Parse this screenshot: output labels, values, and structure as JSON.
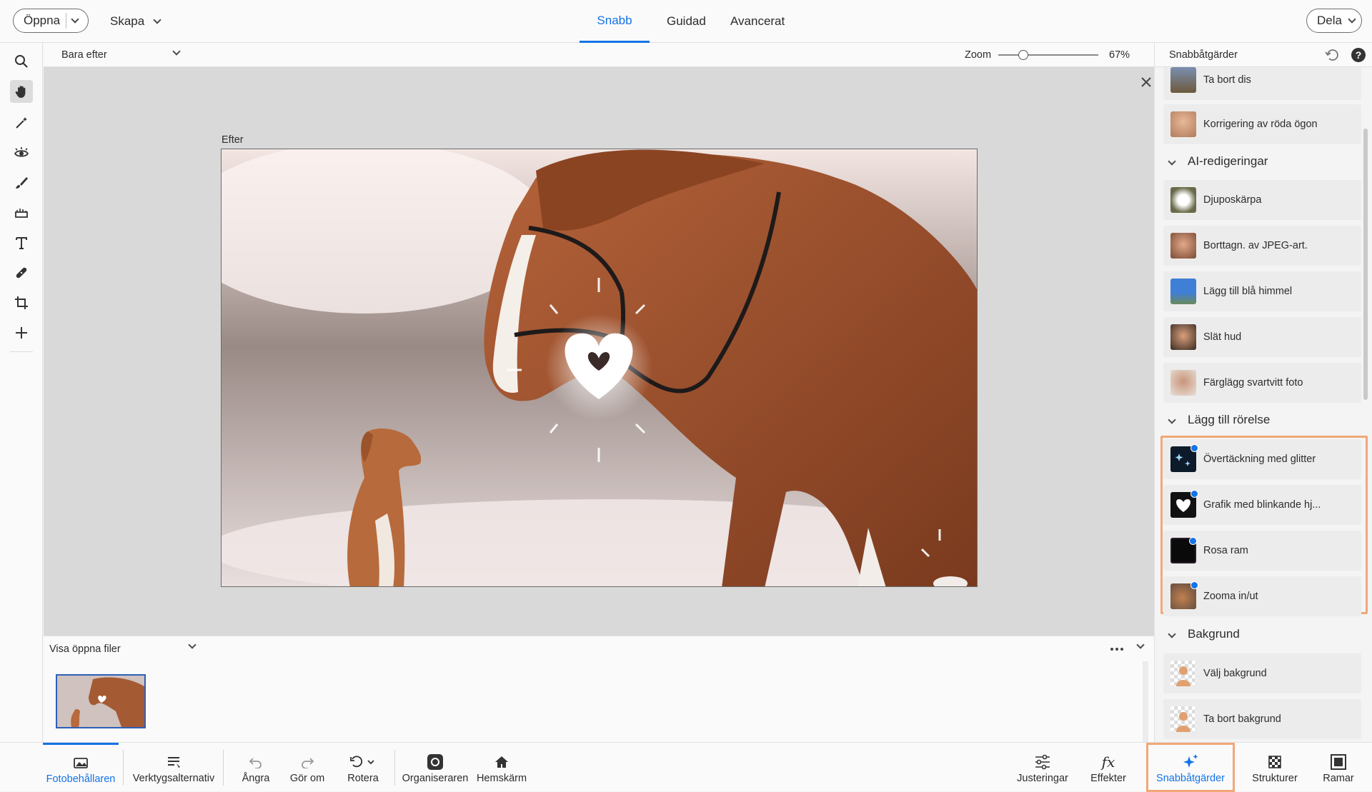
{
  "topbar": {
    "open_label": "Öppna",
    "create_label": "Skapa",
    "modes": [
      "Snabb",
      "Guidad",
      "Avancerat"
    ],
    "share_label": "Dela"
  },
  "subbar": {
    "view_select": "Bara efter",
    "zoom_label": "Zoom",
    "zoom_value": "67%",
    "zoom_fraction": 0.25
  },
  "canvas": {
    "after_label": "Efter"
  },
  "bin": {
    "show_files_label": "Visa öppna filer"
  },
  "panel": {
    "title": "Snabbåtgärder",
    "top_items": [
      {
        "label": "Ta bort dis",
        "icon": "landscape-thumb"
      },
      {
        "label": "Korrigering av röda ögon",
        "icon": "face-thumb"
      }
    ],
    "sections": [
      {
        "title": "AI-redigeringar",
        "items": [
          {
            "label": "Djuposkärpa",
            "icon": "flower-thumb"
          },
          {
            "label": "Borttagn. av JPEG-art.",
            "icon": "portrait-thumb"
          },
          {
            "label": "Lägg till blå himmel",
            "icon": "sky-thumb"
          },
          {
            "label": "Slät hud",
            "icon": "portrait-thumb"
          },
          {
            "label": "Färglägg svartvitt foto",
            "icon": "portrait-thumb"
          }
        ]
      },
      {
        "title": "Lägg till rörelse",
        "items": [
          {
            "label": "Övertäckning med glitter",
            "icon": "glitter-thumb"
          },
          {
            "label": "Grafik med blinkande hj...",
            "icon": "heart-thumb"
          },
          {
            "label": "Rosa ram",
            "icon": "frame-thumb"
          },
          {
            "label": "Zooma in/ut",
            "icon": "zoom-thumb"
          }
        ]
      },
      {
        "title": "Bakgrund",
        "items": [
          {
            "label": "Välj bakgrund",
            "icon": "cutout-thumb"
          },
          {
            "label": "Ta bort bakgrund",
            "icon": "cutout-thumb"
          }
        ]
      }
    ]
  },
  "bottombar": {
    "photo_bin": "Fotobehållaren",
    "tool_options": "Verktygsalternativ",
    "undo": "Ångra",
    "redo": "Gör om",
    "rotate": "Rotera",
    "organizer": "Organiseraren",
    "home": "Hemskärm",
    "adjustments": "Justeringar",
    "effects": "Effekter",
    "quick_actions": "Snabbåtgärder",
    "textures": "Strukturer",
    "frames": "Ramar"
  },
  "colors": {
    "accent": "#1473e6",
    "highlight": "#f0a878"
  }
}
